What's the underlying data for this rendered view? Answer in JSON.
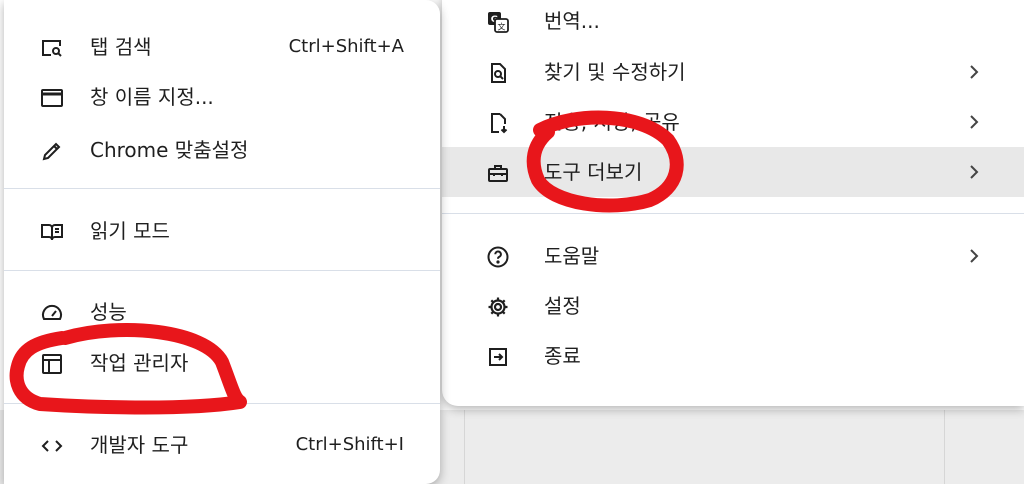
{
  "left_menu": {
    "items": [
      {
        "label": "탭 검색",
        "shortcut": "Ctrl+Shift+A",
        "icon": "tab-search-icon"
      },
      {
        "label": "창 이름 지정...",
        "shortcut": "",
        "icon": "window-icon"
      },
      {
        "label": "Chrome 맞춤설정",
        "shortcut": "",
        "icon": "pencil-icon"
      },
      {
        "label": "읽기 모드",
        "shortcut": "",
        "icon": "book-icon"
      },
      {
        "label": "성능",
        "shortcut": "",
        "icon": "gauge-icon"
      },
      {
        "label": "작업 관리자",
        "shortcut": "",
        "icon": "task-manager-icon"
      },
      {
        "label": "개발자 도구",
        "shortcut": "Ctrl+Shift+I",
        "icon": "code-icon"
      }
    ]
  },
  "right_menu": {
    "items": [
      {
        "label": "번역...",
        "icon": "translate-icon"
      },
      {
        "label": "찾기 및 수정하기",
        "icon": "find-icon"
      },
      {
        "label": "전송, 저장, 공유",
        "icon": "save-share-icon"
      },
      {
        "label": "도구 더보기",
        "icon": "toolbox-icon"
      },
      {
        "label": "도움말",
        "icon": "help-icon"
      },
      {
        "label": "설정",
        "icon": "gear-icon"
      },
      {
        "label": "종료",
        "icon": "exit-icon"
      }
    ]
  },
  "annotation_color": "#e8161b"
}
